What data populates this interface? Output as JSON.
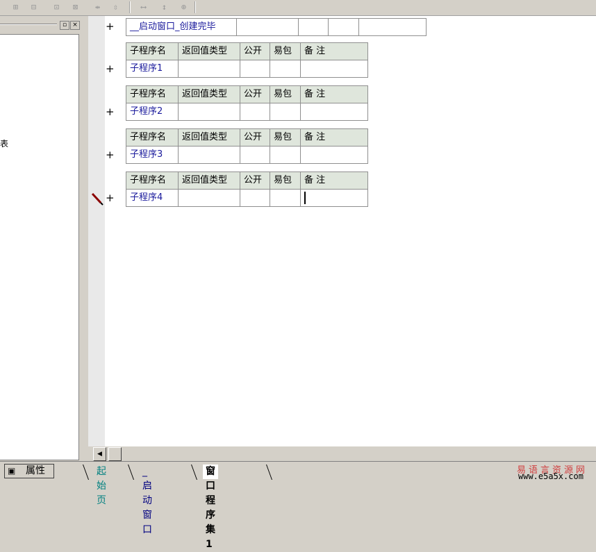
{
  "toolbar": {
    "icons": [
      "align-icon",
      "align-top-icon",
      "align-bottom-icon",
      "align-middle-icon",
      "same-width-icon",
      "same-height-icon",
      "hspace-icon",
      "vspace-icon",
      "center-icon"
    ]
  },
  "left_panel": {
    "fragment_text": "表",
    "restore_glyph": "▫",
    "close_glyph": "×"
  },
  "editor": {
    "window_proc_row": [
      "__启动窗口_创建完毕",
      "",
      "",
      "",
      ""
    ],
    "header": [
      "子程序名",
      "返回值类型",
      "公开",
      "易包",
      "备 注"
    ],
    "subs": [
      {
        "name": "子程序1",
        "ret": "",
        "pub": "",
        "pkg": "",
        "note": ""
      },
      {
        "name": "子程序2",
        "ret": "",
        "pub": "",
        "pkg": "",
        "note": ""
      },
      {
        "name": "子程序3",
        "ret": "",
        "pub": "",
        "pkg": "",
        "note": ""
      },
      {
        "name": "子程序4",
        "ret": "",
        "pub": "",
        "pkg": "",
        "note": ""
      }
    ],
    "plus": "+"
  },
  "scroll": {
    "left_arrow": "◀"
  },
  "bottom": {
    "properties_tab": "属性",
    "tabs": [
      "起始页",
      "_启动窗口",
      "窗口程序集1"
    ],
    "active_tab": "窗口程序集1"
  },
  "watermark": {
    "cn": "易语言资源网",
    "url": "www.e5a5x.com"
  },
  "colors": {
    "link_blue": "#1a1a9c",
    "header_bg": "#dfe6dc",
    "tab_teal": "#008080"
  }
}
